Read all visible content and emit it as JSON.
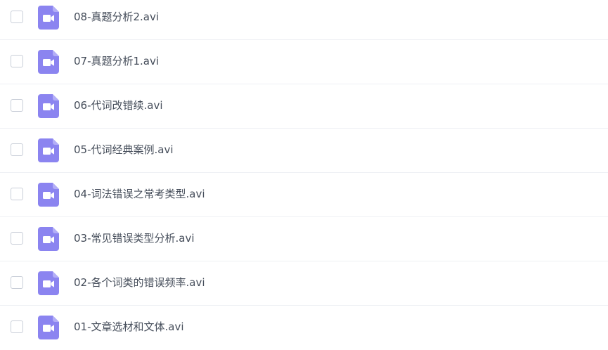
{
  "files": [
    {
      "name": "08-真题分析2.avi",
      "icon": "video-file-icon"
    },
    {
      "name": "07-真题分析1.avi",
      "icon": "video-file-icon"
    },
    {
      "name": "06-代词改错续.avi",
      "icon": "video-file-icon"
    },
    {
      "name": "05-代词经典案例.avi",
      "icon": "video-file-icon"
    },
    {
      "name": "04-词法错误之常考类型.avi",
      "icon": "video-file-icon"
    },
    {
      "name": "03-常见错误类型分析.avi",
      "icon": "video-file-icon"
    },
    {
      "name": "02-各个词类的错误频率.avi",
      "icon": "video-file-icon"
    },
    {
      "name": "01-文章选材和文体.avi",
      "icon": "video-file-icon"
    }
  ],
  "colors": {
    "icon_accent": "#8b84f0",
    "text": "#454d5a",
    "divider": "#eef0f4",
    "checkbox_border": "#c9ced8"
  }
}
